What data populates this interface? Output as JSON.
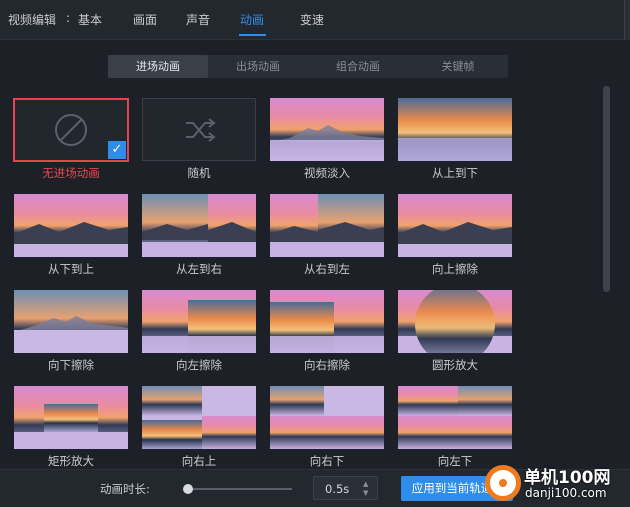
{
  "header": {
    "title": "视频编辑",
    "colon": ":",
    "tabs": [
      {
        "label": "基本",
        "active": false
      },
      {
        "label": "画面",
        "active": false
      },
      {
        "label": "声音",
        "active": false
      },
      {
        "label": "动画",
        "active": true
      },
      {
        "label": "变速",
        "active": false
      }
    ]
  },
  "segments": [
    {
      "label": "进场动画",
      "active": true
    },
    {
      "label": "出场动画",
      "active": false
    },
    {
      "label": "组合动画",
      "active": false
    },
    {
      "label": "关键帧",
      "active": false
    }
  ],
  "animations": [
    {
      "label": "无进场动画",
      "icon": "no-animation-icon",
      "selected": true
    },
    {
      "label": "随机",
      "icon": "shuffle-icon",
      "selected": false
    },
    {
      "label": "视频淡入",
      "icon": "landscape-thumbnail",
      "selected": false
    },
    {
      "label": "从上到下",
      "icon": "landscape-thumbnail",
      "selected": false
    },
    {
      "label": "从下到上",
      "icon": "landscape-thumbnail",
      "selected": false
    },
    {
      "label": "从左到右",
      "icon": "landscape-thumbnail",
      "selected": false
    },
    {
      "label": "从右到左",
      "icon": "landscape-thumbnail",
      "selected": false
    },
    {
      "label": "向上擦除",
      "icon": "landscape-thumbnail",
      "selected": false
    },
    {
      "label": "向下擦除",
      "icon": "landscape-thumbnail",
      "selected": false
    },
    {
      "label": "向左擦除",
      "icon": "landscape-thumbnail",
      "selected": false
    },
    {
      "label": "向右擦除",
      "icon": "landscape-thumbnail",
      "selected": false
    },
    {
      "label": "圆形放大",
      "icon": "landscape-thumbnail",
      "selected": false
    },
    {
      "label": "矩形放大",
      "icon": "landscape-thumbnail",
      "selected": false
    },
    {
      "label": "向右上",
      "icon": "landscape-thumbnail",
      "selected": false
    },
    {
      "label": "向右下",
      "icon": "landscape-thumbnail",
      "selected": false
    },
    {
      "label": "向左下",
      "icon": "landscape-thumbnail",
      "selected": false
    }
  ],
  "bottom": {
    "duration_label": "动画时长:",
    "duration_value": "0.5s",
    "slider_fraction": 0.0,
    "apply_label": "应用到当前轨道"
  },
  "watermark": {
    "brand": "单机100网",
    "url": "danji100.com"
  },
  "colors": {
    "accent": "#2f8dea",
    "selected_border": "#e6454d"
  }
}
